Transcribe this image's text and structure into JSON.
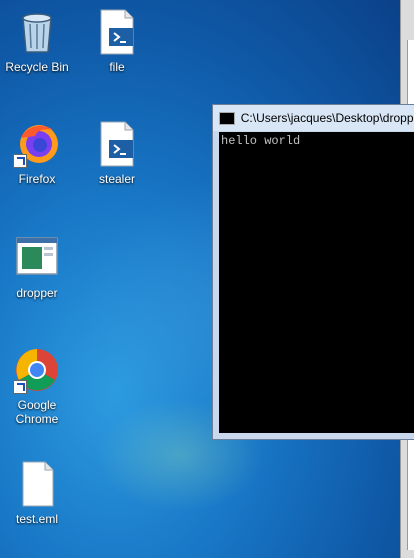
{
  "desktop": {
    "icons": [
      {
        "label": "Recycle Bin"
      },
      {
        "label": "file"
      },
      {
        "label": "Firefox"
      },
      {
        "label": "stealer"
      },
      {
        "label": "dropper"
      },
      {
        "label": "Google Chrome"
      },
      {
        "label": "test.eml"
      }
    ]
  },
  "console_window": {
    "title": "C:\\Users\\jacques\\Desktop\\dropper",
    "output": "hello world"
  },
  "colors": {
    "console_background": "#000000",
    "console_text": "#c0c0c0"
  }
}
